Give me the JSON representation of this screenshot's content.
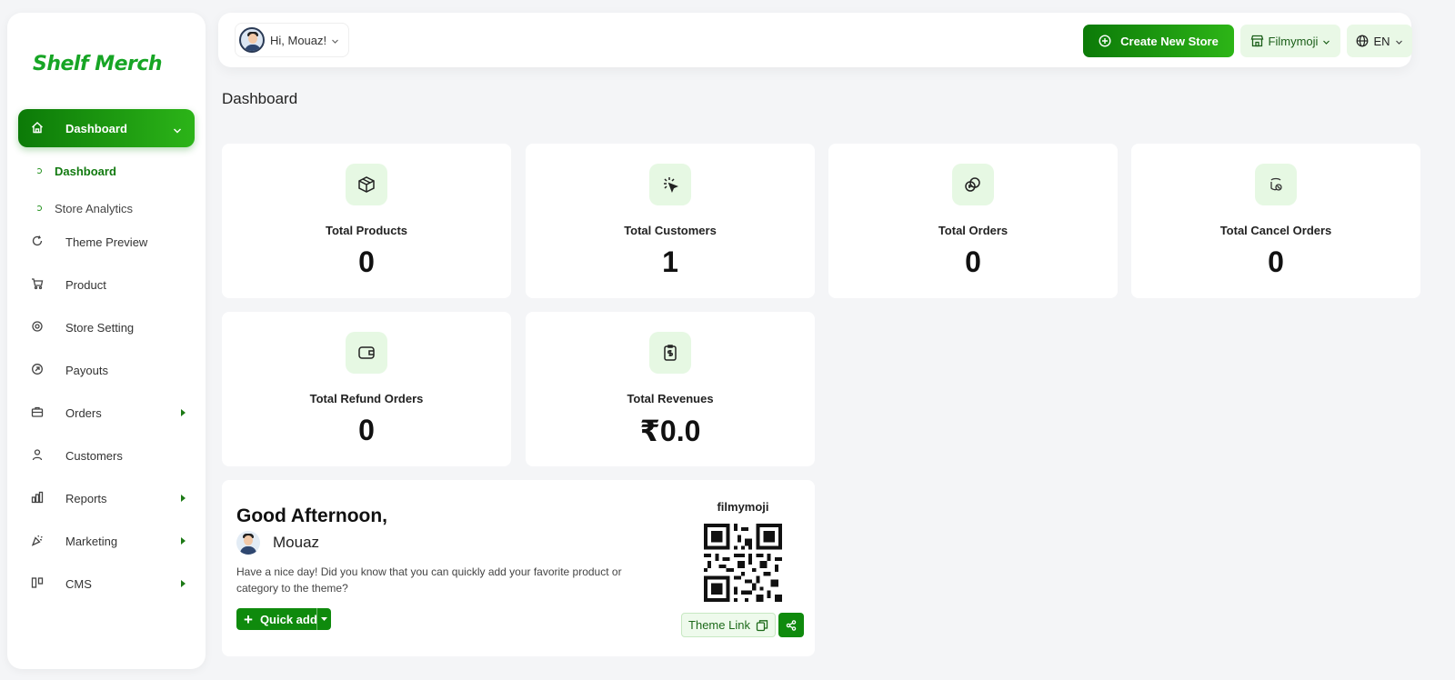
{
  "brand": {
    "logo_text": "Shelf Merch",
    "accent": "#17a525"
  },
  "sidebar": {
    "active_group": "Dashboard",
    "sub_items": [
      {
        "label": "Dashboard",
        "active": true
      },
      {
        "label": "Store Analytics",
        "active": false
      }
    ],
    "items": [
      {
        "label": "Theme Preview",
        "icon": "refresh-icon",
        "has_submenu": false
      },
      {
        "label": "Product",
        "icon": "cart-icon",
        "has_submenu": false
      },
      {
        "label": "Store Setting",
        "icon": "gear-icon",
        "has_submenu": false
      },
      {
        "label": "Payouts",
        "icon": "payout-icon",
        "has_submenu": false
      },
      {
        "label": "Orders",
        "icon": "briefcase-icon",
        "has_submenu": true
      },
      {
        "label": "Customers",
        "icon": "user-icon",
        "has_submenu": false
      },
      {
        "label": "Reports",
        "icon": "bar-chart-icon",
        "has_submenu": true
      },
      {
        "label": "Marketing",
        "icon": "party-icon",
        "has_submenu": true
      },
      {
        "label": "CMS",
        "icon": "layout-icon",
        "has_submenu": true
      }
    ]
  },
  "header": {
    "greeting": "Hi, Mouaz!",
    "create_store_label": "Create New Store",
    "store_selector": "Filmymoji",
    "language": "EN"
  },
  "page": {
    "title": "Dashboard"
  },
  "stats": [
    {
      "label": "Total Products",
      "value": "0",
      "icon": "box-icon"
    },
    {
      "label": "Total Customers",
      "value": "1",
      "icon": "cursor-click-icon"
    },
    {
      "label": "Total Orders",
      "value": "0",
      "icon": "coins-icon"
    },
    {
      "label": "Total Cancel Orders",
      "value": "0",
      "icon": "cancel-coin-icon"
    },
    {
      "label": "Total Refund Orders",
      "value": "0",
      "icon": "wallet-icon"
    },
    {
      "label": "Total Revenues",
      "value": "₹0.0",
      "icon": "receipt-icon"
    }
  ],
  "welcome": {
    "greeting": "Good Afternoon,",
    "user_name": "Mouaz",
    "message": "Have a nice day! Did you know that you can quickly add your favorite product or category to the theme?",
    "quick_add_label": "Quick add",
    "store_name": "filmymoji",
    "theme_link_label": "Theme Link"
  }
}
